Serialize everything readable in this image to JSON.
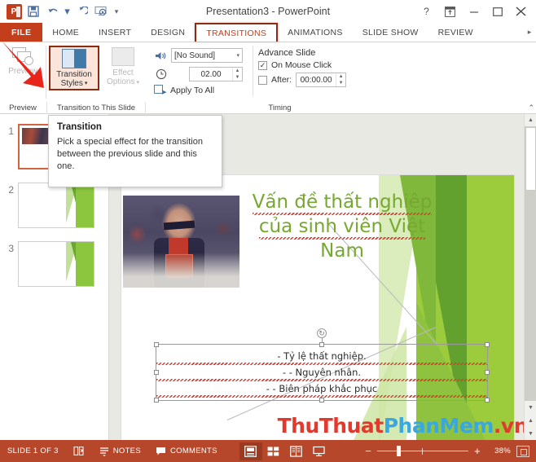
{
  "titlebar": {
    "document_title": "Presentation3 - PowerPoint",
    "qat": [
      {
        "name": "powerpoint-logo",
        "glyph": "P"
      },
      {
        "name": "save-icon",
        "glyph": "὚B"
      },
      {
        "name": "undo-icon",
        "glyph": "↶"
      },
      {
        "name": "undo-dropdown-icon",
        "glyph": "▾"
      },
      {
        "name": "redo-icon",
        "glyph": "↻"
      },
      {
        "name": "start-slideshow-icon",
        "glyph": "⬜"
      },
      {
        "name": "customize-qat-icon",
        "glyph": "☰"
      }
    ],
    "window_controls": [
      {
        "name": "help-button",
        "glyph": "?"
      },
      {
        "name": "ribbon-display-options-button",
        "glyph": "⬆"
      },
      {
        "name": "minimize-button",
        "glyph": "–"
      },
      {
        "name": "maximize-button",
        "glyph": "☐"
      },
      {
        "name": "close-button",
        "glyph": "✕"
      }
    ]
  },
  "tabs": {
    "file_label": "FILE",
    "items": [
      {
        "label": "HOME",
        "active": false
      },
      {
        "label": "INSERT",
        "active": false
      },
      {
        "label": "DESIGN",
        "active": false
      },
      {
        "label": "TRANSITIONS",
        "active": true
      },
      {
        "label": "ANIMATIONS",
        "active": false
      },
      {
        "label": "SLIDE SHOW",
        "active": false
      },
      {
        "label": "REVIEW",
        "active": false
      }
    ],
    "overflow_glyph": "▸"
  },
  "ribbon": {
    "groups": [
      {
        "label": "Preview"
      },
      {
        "label": "Transition to This Slide"
      },
      {
        "label": "Timing"
      }
    ],
    "preview_button": {
      "label": "Preview",
      "enabled": false
    },
    "transition_styles_button": {
      "label_line1": "Transition",
      "label_line2": "Styles",
      "dropdown_glyph": "▾",
      "highlighted": true
    },
    "effect_options_button": {
      "label_line1": "Effect",
      "label_line2": "Options",
      "dropdown_glyph": "▾",
      "enabled": false
    },
    "timing": {
      "sound_value": "[No Sound]",
      "sound_arrow": "▾",
      "duration_value": "02.00",
      "apply_to_all_label": "Apply To All"
    },
    "advance_slide": {
      "title": "Advance Slide",
      "on_mouse_click_label": "On Mouse Click",
      "on_mouse_click_checked": true,
      "after_label": "After:",
      "after_value": "00:00.00",
      "after_checked": false
    }
  },
  "tooltip": {
    "title": "Transition",
    "body": "Pick a special effect for the transition between the previous slide and this one."
  },
  "slide_panel": {
    "thumbnails": [
      {
        "number": "1",
        "selected": true,
        "has_photo": true
      },
      {
        "number": "2",
        "selected": false,
        "has_photo": false
      },
      {
        "number": "3",
        "selected": false,
        "has_photo": false
      }
    ]
  },
  "slide": {
    "title_lines": [
      "Vấn đề thất nghiêp",
      "của sinh viên Việt",
      "Nam"
    ],
    "title_color": "#76a830",
    "bullets": [
      "-   Tỷ lệ thất nghiệp.",
      "-    - Nguyên nhân.",
      "-   - Biên pháp khắc phục"
    ],
    "accent_color": "#9ccb3b"
  },
  "watermark": {
    "part_a": "ThuThuat",
    "part_b": "PhanMem",
    "part_c": ".vn",
    "color_a": "#e03a2f",
    "color_b": "#3aa8e0"
  },
  "statusbar": {
    "slide_counter": "SLIDE 1 OF 3",
    "language_icon": "文",
    "notes_label": "NOTES",
    "comments_label": "COMMENTS",
    "views": [
      {
        "name": "normal-view",
        "glyph": "▤",
        "active": true
      },
      {
        "name": "slide-sorter-view",
        "glyph": "▒",
        "active": false
      },
      {
        "name": "reading-view",
        "glyph": "☷",
        "active": false
      },
      {
        "name": "slideshow-view",
        "glyph": "☐",
        "active": false
      }
    ],
    "zoom_out_glyph": "−",
    "zoom_in_glyph": "+",
    "zoom_percent": "38%"
  },
  "scrollbar": {
    "up_glyph": "▲",
    "down_glyph": "▼",
    "prev_slide_glyph": "▲",
    "next_slide_glyph": "▼",
    "collapse_ribbon_glyph": "⌃"
  }
}
